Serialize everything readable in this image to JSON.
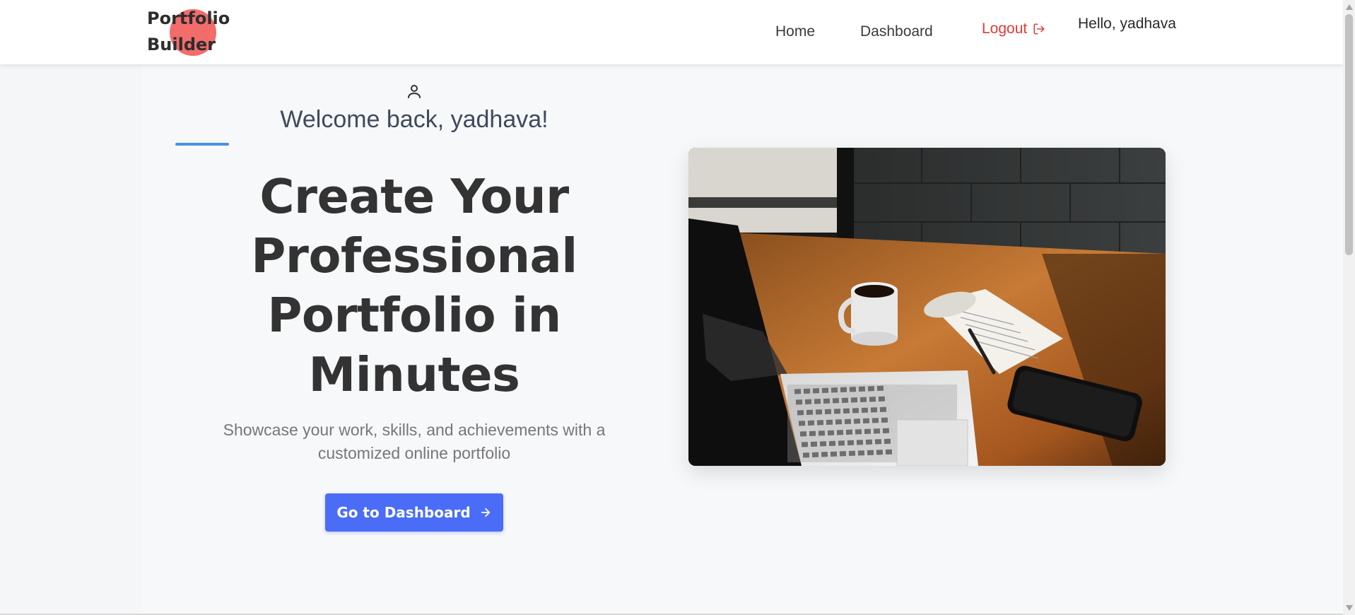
{
  "brand": {
    "line1": "Portfolio",
    "line2": "Builder",
    "accent_color": "#f25c5c"
  },
  "nav": {
    "home": "Home",
    "dashboard": "Dashboard",
    "logout": "Logout",
    "hello": "Hello, yadhava",
    "logout_color": "#e53935",
    "logout_icon": "logout-icon"
  },
  "hero": {
    "user_icon": "user-icon",
    "welcome": "Welcome back, yadhava!",
    "headline": "Create Your Professional Portfolio in Minutes",
    "subtitle": "Showcase your work, skills, and achievements with a customized online portfolio",
    "cta_label": "Go to Dashboard",
    "cta_icon": "arrow-right-icon",
    "cta_color": "#4a6cf7",
    "accent_line_color": "#4a90e2",
    "image_icon": "workspace-photo"
  }
}
